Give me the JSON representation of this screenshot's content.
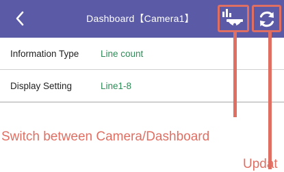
{
  "header": {
    "title": "Dashboard【Camera1】",
    "back_icon": "chevron-left-icon",
    "switch_icon": "camera-dashboard-switch-icon",
    "update_icon": "refresh-icon",
    "background_color": "#5b5aa6"
  },
  "settings": {
    "rows": [
      {
        "label": "Information Type",
        "value": "Line count"
      },
      {
        "label": "Display Setting",
        "value": "Line1-8"
      }
    ],
    "value_color": "#2e8b57"
  },
  "annotations": {
    "switch_label": "Switch between Camera/Dashboard",
    "update_label": "Updat",
    "color": "#e06f63"
  }
}
